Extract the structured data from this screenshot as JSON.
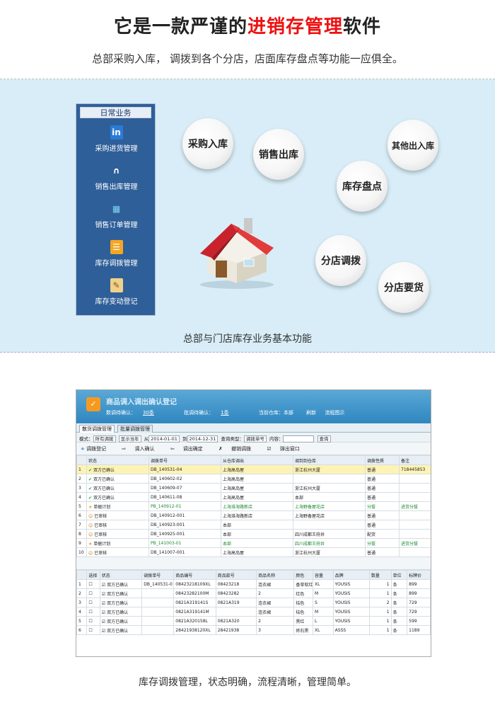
{
  "header": {
    "title_pre": "它是一款严谨的",
    "title_highlight": "进销存管理",
    "title_post": "软件",
    "subtitle": "总部采购入库， 调拨到各个分店，店面库存盘点等功能一应俱全。"
  },
  "menu": {
    "title": "日常业务",
    "items": [
      {
        "label": "采购进货管理",
        "icon": "in-icon"
      },
      {
        "label": "销售出库管理",
        "icon": "trousers-icon"
      },
      {
        "label": "销售订单管理",
        "icon": "book-icon"
      },
      {
        "label": "库存调拨管理",
        "icon": "checklist-icon"
      },
      {
        "label": "库存变动登记",
        "icon": "notepad-icon"
      }
    ]
  },
  "bubbles": [
    "采购入库",
    "销售出库",
    "其他出入库",
    "库存盘点",
    "分店调拨",
    "分店要货"
  ],
  "caption1": "总部与门店库存业务基本功能",
  "app": {
    "title": "商品调入调出确认登记",
    "pending_label": "数调待确认：",
    "pending_value": "30条",
    "batch_label": "批调待确认：",
    "batch_value": "1条",
    "store_label": "当前仓库：本部",
    "refresh": "刷新",
    "flow": "流程图示",
    "tabs": [
      "散货调拨管理",
      "批量调拨管理"
    ],
    "filter": {
      "mode_label": "模式：",
      "mode": "所有调拨",
      "year": "显示当年",
      "from_label": "从",
      "from": "2014-01-01",
      "to_label": "到",
      "to": "2014-12-31",
      "type_label": "查询类型：",
      "type": "调拨单号",
      "content_label": "内容：",
      "search": "查询"
    },
    "tools": [
      "调拨登记",
      "调入确认",
      "调出确定",
      "撤销调拨",
      "弹出窗口"
    ],
    "top_headers": [
      "状态",
      "调拨单号",
      "从仓库调出",
      "调到到仓库",
      "调拨性质",
      "备注"
    ],
    "top_rows": [
      {
        "n": "1",
        "status": "双方已确认",
        "no": "DB_140531-04",
        "from": "上海高岛屋",
        "to": "浙江杭州大厦",
        "kind": "普通",
        "note": "718445853",
        "cls": "sel"
      },
      {
        "n": "2",
        "status": "双方已确认",
        "no": "DB_140602-02",
        "from": "上海高岛屋",
        "to": "",
        "kind": "普通",
        "note": ""
      },
      {
        "n": "3",
        "status": "双方已确认",
        "no": "DB_140609-07",
        "from": "上海高岛屋",
        "to": "浙江杭州大厦",
        "kind": "普通",
        "note": ""
      },
      {
        "n": "4",
        "status": "双方已确认",
        "no": "DB_140611-08",
        "from": "上海高岛屋",
        "to": "本部",
        "kind": "普通",
        "note": ""
      },
      {
        "n": "5",
        "status": "单据计划",
        "no": "PB_140912-01",
        "from": "上海淮海路新店",
        "to": "上海野备屋花店",
        "kind": "分拔",
        "note": "进货分拔",
        "cls": "g"
      },
      {
        "n": "6",
        "status": "已审核",
        "no": "DB_140912-001",
        "from": "上海淮海路新店",
        "to": "上海野备屋花店",
        "kind": "普通",
        "note": ""
      },
      {
        "n": "7",
        "status": "已审核",
        "no": "DB_140923-001",
        "from": "本部",
        "to": "",
        "kind": "普通",
        "note": ""
      },
      {
        "n": "8",
        "status": "已审核",
        "no": "DB_140925-001",
        "from": "本部",
        "to": "四川成都王府井",
        "kind": "配货",
        "note": ""
      },
      {
        "n": "9",
        "status": "单据计划",
        "no": "PB_141003-01",
        "from": "本部",
        "to": "四川成都王府井",
        "kind": "分拔",
        "note": "进货分拔",
        "cls": "g"
      },
      {
        "n": "10",
        "status": "已审核",
        "no": "DB_141007-001",
        "from": "上海高岛屋",
        "to": "浙江杭州大厦",
        "kind": "普通",
        "note": ""
      }
    ],
    "bottom_headers": [
      "选择",
      "状态",
      "调拨单号",
      "商品编号",
      "商品款号",
      "商品名称",
      "颜色",
      "容量",
      "品牌",
      "数量",
      "单位",
      "标牌价"
    ],
    "bottom_rows": [
      {
        "n": "1",
        "status": "双方已确认",
        "no": "DB_140531-0",
        "code": "08423218109XL",
        "sku": "08423218",
        "name": "连衣裙",
        "color": "香草软红",
        "size": "XL",
        "brand": "YOUSIS",
        "qty": "1",
        "unit": "条",
        "price": "899"
      },
      {
        "n": "2",
        "status": "双方已确认",
        "no": "",
        "code": "08423282100M",
        "sku": "08423282",
        "name": "2",
        "color": "红色",
        "size": "M",
        "brand": "YOUSIS",
        "qty": "1",
        "unit": "条",
        "price": "899"
      },
      {
        "n": "3",
        "status": "双方已确认",
        "no": "",
        "code": "0821A319141S",
        "sku": "0821A319",
        "name": "连衣裙",
        "color": "桔色",
        "size": "S",
        "brand": "YOUSIS",
        "qty": "2",
        "unit": "条",
        "price": "729"
      },
      {
        "n": "4",
        "status": "双方已确认",
        "no": "",
        "code": "0821A319141M",
        "sku": "",
        "name": "连衣裙",
        "color": "桔色",
        "size": "M",
        "brand": "YOUSIS",
        "qty": "1",
        "unit": "条",
        "price": "729"
      },
      {
        "n": "5",
        "status": "双方已确认",
        "no": "",
        "code": "0821A320158L",
        "sku": "0821A320",
        "name": "2",
        "color": "黑红",
        "size": "L",
        "brand": "YOUSIS",
        "qty": "1",
        "unit": "条",
        "price": "599"
      },
      {
        "n": "6",
        "status": "双方已确认",
        "no": "",
        "code": "28421938120XL",
        "sku": "28421938",
        "name": "3",
        "color": "砖石黑",
        "size": "XL",
        "brand": "ASSS",
        "qty": "1",
        "unit": "条",
        "price": "1189"
      }
    ]
  },
  "caption2": "库存调拨管理，状态明确，流程清晰，管理简单。"
}
